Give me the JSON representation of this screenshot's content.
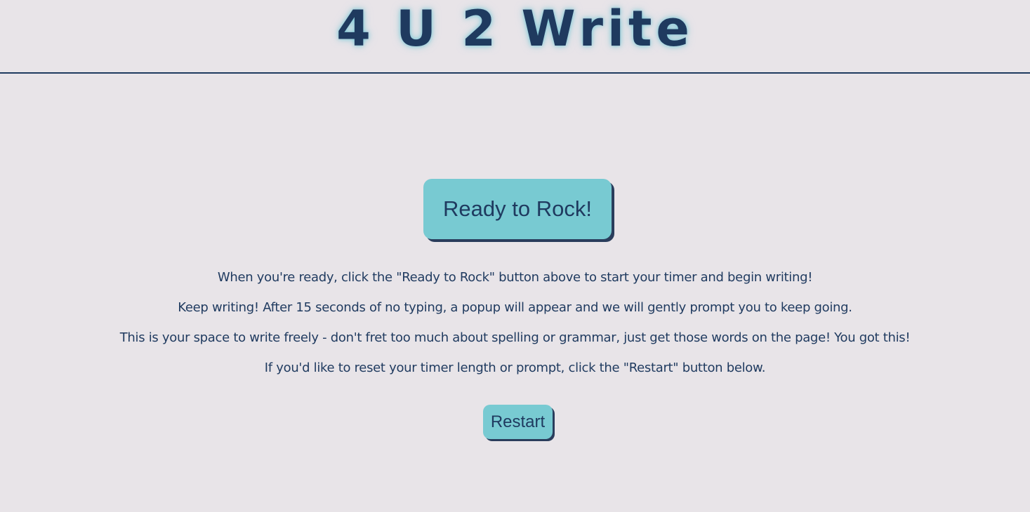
{
  "header": {
    "title": "4 U 2 Write"
  },
  "main": {
    "start_button_label": "Ready to Rock!",
    "instructions": [
      "When you're ready, click the \"Ready to Rock\" button above to start your timer and begin writing!",
      "Keep writing! After 15 seconds of no typing, a popup will appear and we will gently prompt you to keep going.",
      "This is your space to write freely - don't fret too much about spelling or grammar, just get those words on the page! You got this!",
      "If you'd like to reset your timer length or prompt, click the \"Restart\" button below."
    ],
    "restart_button_label": "Restart"
  },
  "colors": {
    "background": "#e8e4e8",
    "text": "#1f3a5f",
    "button": "#78cad2",
    "button_shadow": "#2a3d5c"
  }
}
